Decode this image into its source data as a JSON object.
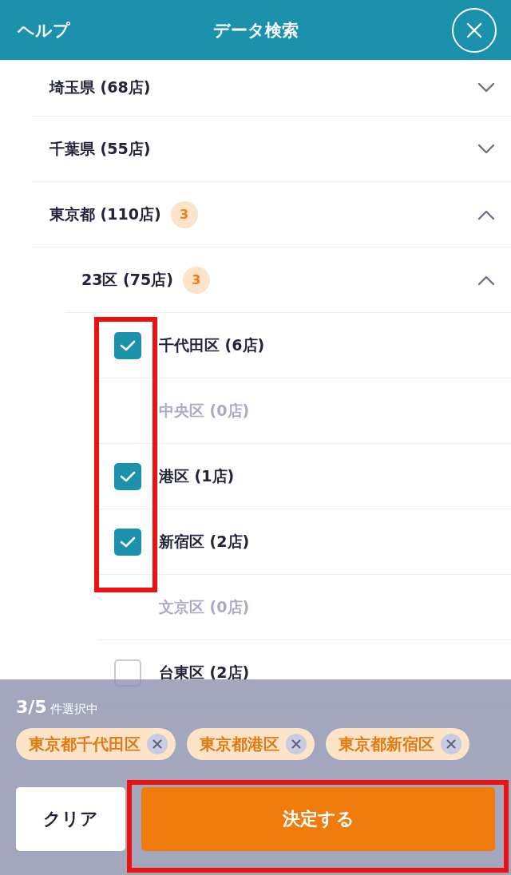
{
  "header": {
    "help": "ヘルプ",
    "title": "データ検索"
  },
  "areas": [
    {
      "label": "埼玉県 (68店)",
      "expanded": false
    },
    {
      "label": "千葉県 (55店)",
      "expanded": false
    },
    {
      "label": "東京都 (110店)",
      "badge": "3",
      "expanded": true,
      "children": [
        {
          "label": "23区 (75店)",
          "badge": "3",
          "expanded": true,
          "children": [
            {
              "label": "千代田区 (6店)",
              "checked": true,
              "disabled": false
            },
            {
              "label": "中央区 (0店)",
              "disabled": true
            },
            {
              "label": "港区 (1店)",
              "checked": true,
              "disabled": false
            },
            {
              "label": "新宿区 (2店)",
              "checked": true,
              "disabled": false
            },
            {
              "label": "文京区 (0店)",
              "disabled": true
            },
            {
              "label": "台東区 (2店)",
              "checked": false,
              "disabled": false
            }
          ]
        }
      ]
    }
  ],
  "selection": {
    "count": "3/5",
    "label": "件選択中",
    "chips": [
      "東京都千代田区",
      "東京都港区",
      "東京都新宿区"
    ]
  },
  "buttons": {
    "clear": "クリア",
    "submit": "決定する"
  }
}
